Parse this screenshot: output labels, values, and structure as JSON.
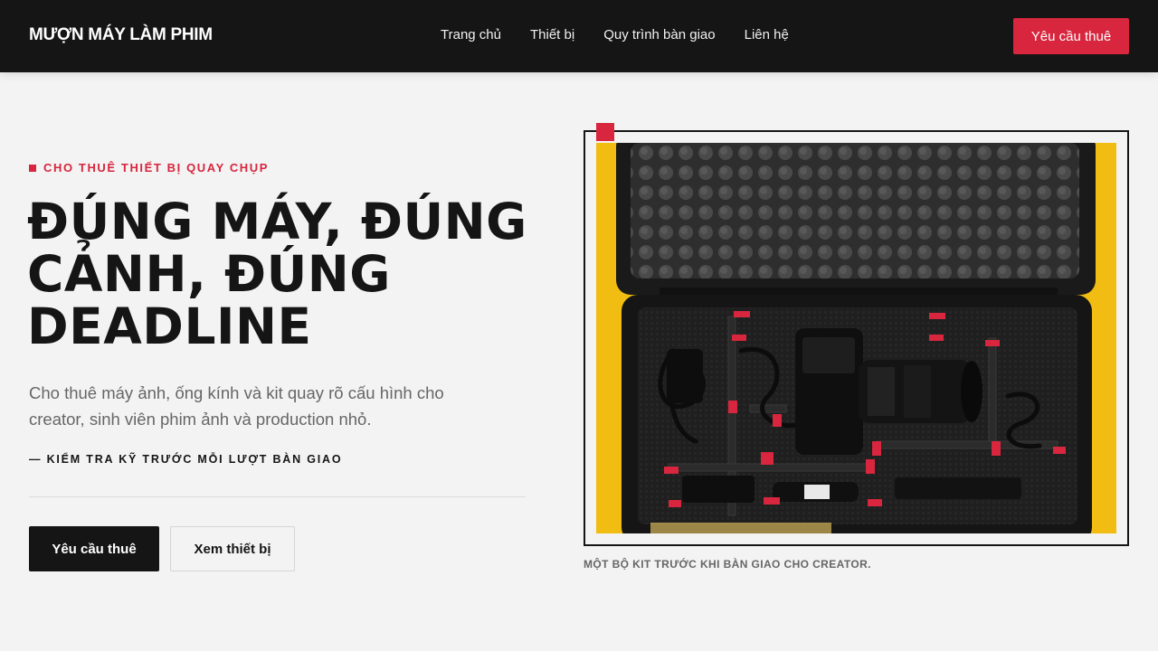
{
  "header": {
    "brand": "MƯỢN MÁY LÀM PHIM",
    "nav": [
      "Trang chủ",
      "Thiết bị",
      "Quy trình bàn giao",
      "Liên hệ"
    ],
    "cta": "Yêu cầu thuê"
  },
  "hero": {
    "eyebrow": "CHO THUÊ THIẾT BỊ QUAY CHỤP",
    "headline": [
      "ĐÚNG MÁY, ĐÚNG",
      "CẢNH, ĐÚNG",
      "DEADLINE"
    ],
    "lead": "Cho thuê máy ảnh, ống kính và kit quay rõ cấu hình cho creator, sinh viên phim ảnh và production nhỏ.",
    "note": "— KIỂM TRA KỸ TRƯỚC MỖI LƯỢT BÀN GIAO",
    "primary_button": "Yêu cầu thuê",
    "secondary_button": "Xem thiết bị",
    "caption": "MỘT BỘ KIT TRƯỚC KHI BÀN GIAO CHO CREATOR."
  },
  "colors": {
    "accent": "#d7263d",
    "dark": "#151515",
    "background": "#f3f3f3",
    "photo_backdrop": "#f2bd12"
  }
}
